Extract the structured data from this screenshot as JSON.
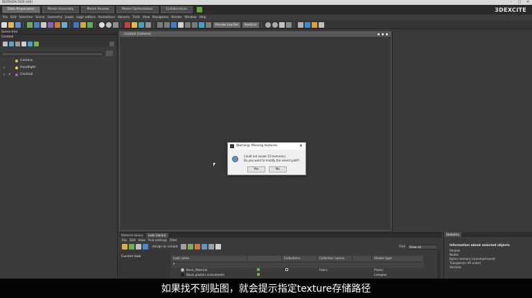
{
  "window": {
    "title": "DELTAGEN 2020 (x64)"
  },
  "brand": "3DEXCITE",
  "module_tabs": [
    "Data Preparation",
    "Model Assembly",
    "Model Review",
    "Model Optimization",
    "Collaboration"
  ],
  "menu": [
    "File",
    "Edit",
    "Selection",
    "Scene",
    "Geometry",
    "Looks",
    "Logic editors",
    "Animations",
    "Variants",
    "Tools",
    "View",
    "Navigation",
    "Render",
    "Window",
    "Help"
  ],
  "toolbar": {
    "btn_a": "Preview Low Def",
    "btn_b": "Realtime"
  },
  "scene_tree": {
    "title": "Scene tree",
    "root": "Cocktail",
    "items": [
      "Camera",
      "Headlight",
      "Cocktail"
    ]
  },
  "viewport": {
    "title": "Cocktail (Camera)"
  },
  "dialog": {
    "title": "Warning: Missing textures",
    "line1": "Could not locate 15 texture(s).",
    "line2": "Do you want to modify the search path?",
    "yes": "Yes",
    "no": "No"
  },
  "look_panel": {
    "tabs": [
      "Material library",
      "Look Library"
    ],
    "menu": [
      "File",
      "Edit",
      "View",
      "Find settings",
      "Filter"
    ],
    "assign_label": "Assign as variant",
    "find_label": "Find",
    "find_value": "Show all",
    "current_look": "Current look",
    "columns": [
      "Look name",
      "Collections",
      "Collection names",
      "Shader type"
    ],
    "rows": [
      {
        "name": "Basic_Material",
        "collection": "Fabric",
        "shader": "Plastic"
      },
      {
        "name": "Black plastics instruments",
        "collection": "",
        "shader": "Complex"
      }
    ]
  },
  "statistics": {
    "title": "Statistics",
    "heading": "Information about selected objects",
    "rows": [
      "Shapes",
      "Nodes",
      "Bytes memory (uncompressed)",
      "Triangles(in VR order)",
      "Vertices"
    ]
  },
  "subtitle": "如果找不到贴图，就会提示指定texture存储路径",
  "colors": {
    "accent_blue": "#6d8fb3",
    "subtitle_bg": "#050505"
  }
}
